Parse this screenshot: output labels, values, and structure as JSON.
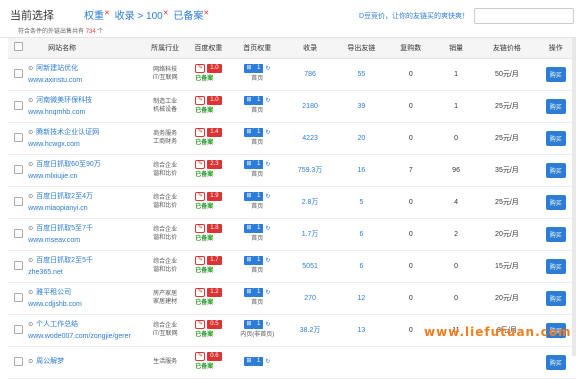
{
  "header": {
    "current_label": "当前选择",
    "filters": [
      {
        "label": "权重",
        "x": "✕"
      },
      {
        "label": "收录 > 100",
        "x": "✕"
      },
      {
        "label": "已备案",
        "x": "✕"
      }
    ],
    "hint": "D豆竞价，让你的友链买的爽快爽！",
    "count_prefix": "符合条件的外链出售共有",
    "count_value": "734",
    "count_suffix": "个"
  },
  "columns": [
    "网站名称",
    "所属行业",
    "百度权重",
    "首页权重",
    "收录",
    "导出友链",
    "复购数",
    "销量",
    "友链价格",
    "操作"
  ],
  "rows": [
    {
      "name": "阿新建站优化",
      "url": "www.axinstu.com",
      "industry": [
        "网络科技",
        "IT/互联网"
      ],
      "br": "1.0",
      "hp": "1",
      "hp_label": "首页",
      "index": "786",
      "out": "55",
      "rebuy": "0",
      "sales": "1",
      "price": "50元/月"
    },
    {
      "name": "河南微美环保科技",
      "url": "www.hnqmhb.com",
      "industry": [
        "制造工业",
        "机械设备"
      ],
      "br": "1.0",
      "hp": "1",
      "hp_label": "首页",
      "index": "2180",
      "out": "39",
      "rebuy": "0",
      "sales": "1",
      "price": "25元/月"
    },
    {
      "name": "腾新技术企业认证网",
      "url": "www.hcwgx.com",
      "industry": [
        "商务服务",
        "工商财务"
      ],
      "br": "1.4",
      "hp": "1",
      "hp_label": "首页",
      "index": "4223",
      "out": "20",
      "rebuy": "0",
      "sales": "0",
      "price": "25元/月"
    },
    {
      "name": "百度日抓取60至90万",
      "url": "www.mlxiujie.cn",
      "industry": [
        "综合企业",
        "谐和比价"
      ],
      "br": "2.3",
      "hp": "1",
      "hp_label": "首页",
      "index": "759.3万",
      "out": "16",
      "rebuy": "7",
      "sales": "96",
      "price": "35元/月"
    },
    {
      "name": "百度日抓取2至4万",
      "url": "www.miaopianyi.cn",
      "industry": [
        "综合企业",
        "谐和比价"
      ],
      "br": "1.9",
      "hp": "1",
      "hp_label": "首页",
      "index": "2.8万",
      "out": "5",
      "rebuy": "0",
      "sales": "4",
      "price": "25元/月"
    },
    {
      "name": "百度日抓取5至7千",
      "url": "www.mseav.com",
      "industry": [
        "综合企业",
        "谐和比价"
      ],
      "br": "1.8",
      "hp": "1",
      "hp_label": "首页",
      "index": "1.7万",
      "out": "6",
      "rebuy": "0",
      "sales": "2",
      "price": "20元/月"
    },
    {
      "name": "百度日抓取2至5千",
      "url": "zhe365.net",
      "industry": [
        "综合企业",
        "谐和比价"
      ],
      "br": "1.7",
      "hp": "1",
      "hp_label": "首页",
      "index": "5051",
      "out": "6",
      "rebuy": "0",
      "sales": "0",
      "price": "15元/月"
    },
    {
      "name": "雅平租公司",
      "url": "www.cdjjshb.com",
      "industry": [
        "房产家居",
        "家居建材"
      ],
      "br": "1.2",
      "hp": "1",
      "hp_label": "首页",
      "index": "270",
      "out": "12",
      "rebuy": "0",
      "sales": "0",
      "price": "20元/月"
    },
    {
      "name": "个人工作总结",
      "url": "www.wode007.com/zongjie/gerer",
      "industry": [
        "综合企业",
        "IT/互联网"
      ],
      "br": "0.5",
      "hp": "1",
      "hp_label": "内页(非首页)",
      "index": "38.2万",
      "out": "13",
      "rebuy": "0",
      "sales": "11",
      "price": "8元/月"
    },
    {
      "name": "周公解梦",
      "url": "",
      "industry": [
        "生活服务",
        ""
      ],
      "br": "0.6",
      "hp": "1",
      "hp_label": "",
      "index": "",
      "out": "",
      "rebuy": "",
      "sales": "",
      "price": ""
    }
  ],
  "row_status": "已备案",
  "buy_label": "购买",
  "watermark": "www.liefutuan.com"
}
